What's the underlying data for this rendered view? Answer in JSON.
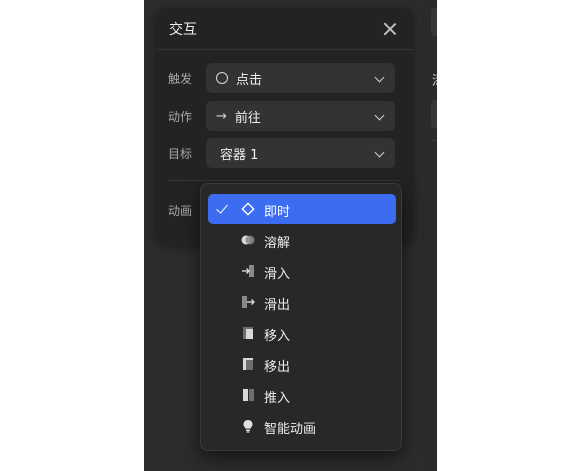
{
  "panel": {
    "title": "交互",
    "fields": [
      {
        "label": "触发",
        "value": "点击",
        "icon": "circle-icon"
      },
      {
        "label": "动作",
        "value": "前往",
        "icon": "arrow-right-icon"
      },
      {
        "label": "目标",
        "value": "容器 1",
        "icon": ""
      },
      {
        "label": "动画",
        "value": "即时",
        "icon": "diamond-icon"
      }
    ]
  },
  "side": {
    "partial_glyph": "添"
  },
  "dropdown": {
    "selected_index": 0,
    "options": [
      {
        "label": "即时",
        "icon": "diamond-icon"
      },
      {
        "label": "溶解",
        "icon": "dissolve-icon"
      },
      {
        "label": "滑入",
        "icon": "slide-in-icon"
      },
      {
        "label": "滑出",
        "icon": "slide-out-icon"
      },
      {
        "label": "移入",
        "icon": "move-in-icon"
      },
      {
        "label": "移出",
        "icon": "move-out-icon"
      },
      {
        "label": "推入",
        "icon": "push-icon"
      },
      {
        "label": "智能动画",
        "icon": "smart-animate-icon"
      }
    ]
  },
  "colors": {
    "accent": "#3c6cf0",
    "panel": "#232323",
    "background": "#2c2c2c"
  }
}
